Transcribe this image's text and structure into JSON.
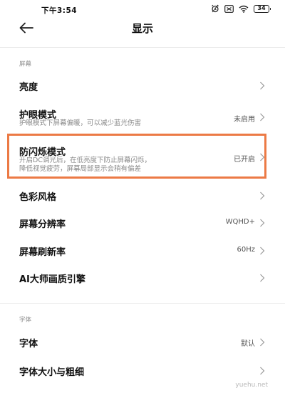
{
  "status_bar": {
    "time": "下午3:54",
    "battery": "34",
    "icons": [
      "alarm-icon",
      "sim-icon",
      "wifi-icon",
      "battery-icon"
    ]
  },
  "header": {
    "back_icon": "back-arrow-icon",
    "title": "显示"
  },
  "sections": {
    "screen": {
      "label": "屏幕",
      "brightness": {
        "title": "亮度"
      },
      "eye_care": {
        "title": "护眼模式",
        "subtitle": "护眼模式下屏幕偏暖，可以减少蓝光伤害",
        "value": "未启用"
      },
      "anti_flicker": {
        "title": "防闪烁模式",
        "subtitle_line1": "开启DC调光后，在低亮度下防止屏幕闪烁，",
        "subtitle_line2": "降低视觉疲劳，屏幕局部显示会稍有偏差",
        "value": "已开启",
        "highlighted": true,
        "highlight_color": "#ec7a45"
      },
      "color_style": {
        "title": "色彩风格"
      },
      "resolution": {
        "title": "屏幕分辨率",
        "value": "WQHD+"
      },
      "refresh_rate": {
        "title": "屏幕刷新率",
        "value": "60Hz"
      },
      "ai_engine": {
        "title": "AI大师画质引擎"
      }
    },
    "font": {
      "label": "字体",
      "font": {
        "title": "字体",
        "value": "默认"
      },
      "font_size": {
        "title": "字体大小与粗细"
      }
    }
  },
  "watermark": "yuehu.net"
}
